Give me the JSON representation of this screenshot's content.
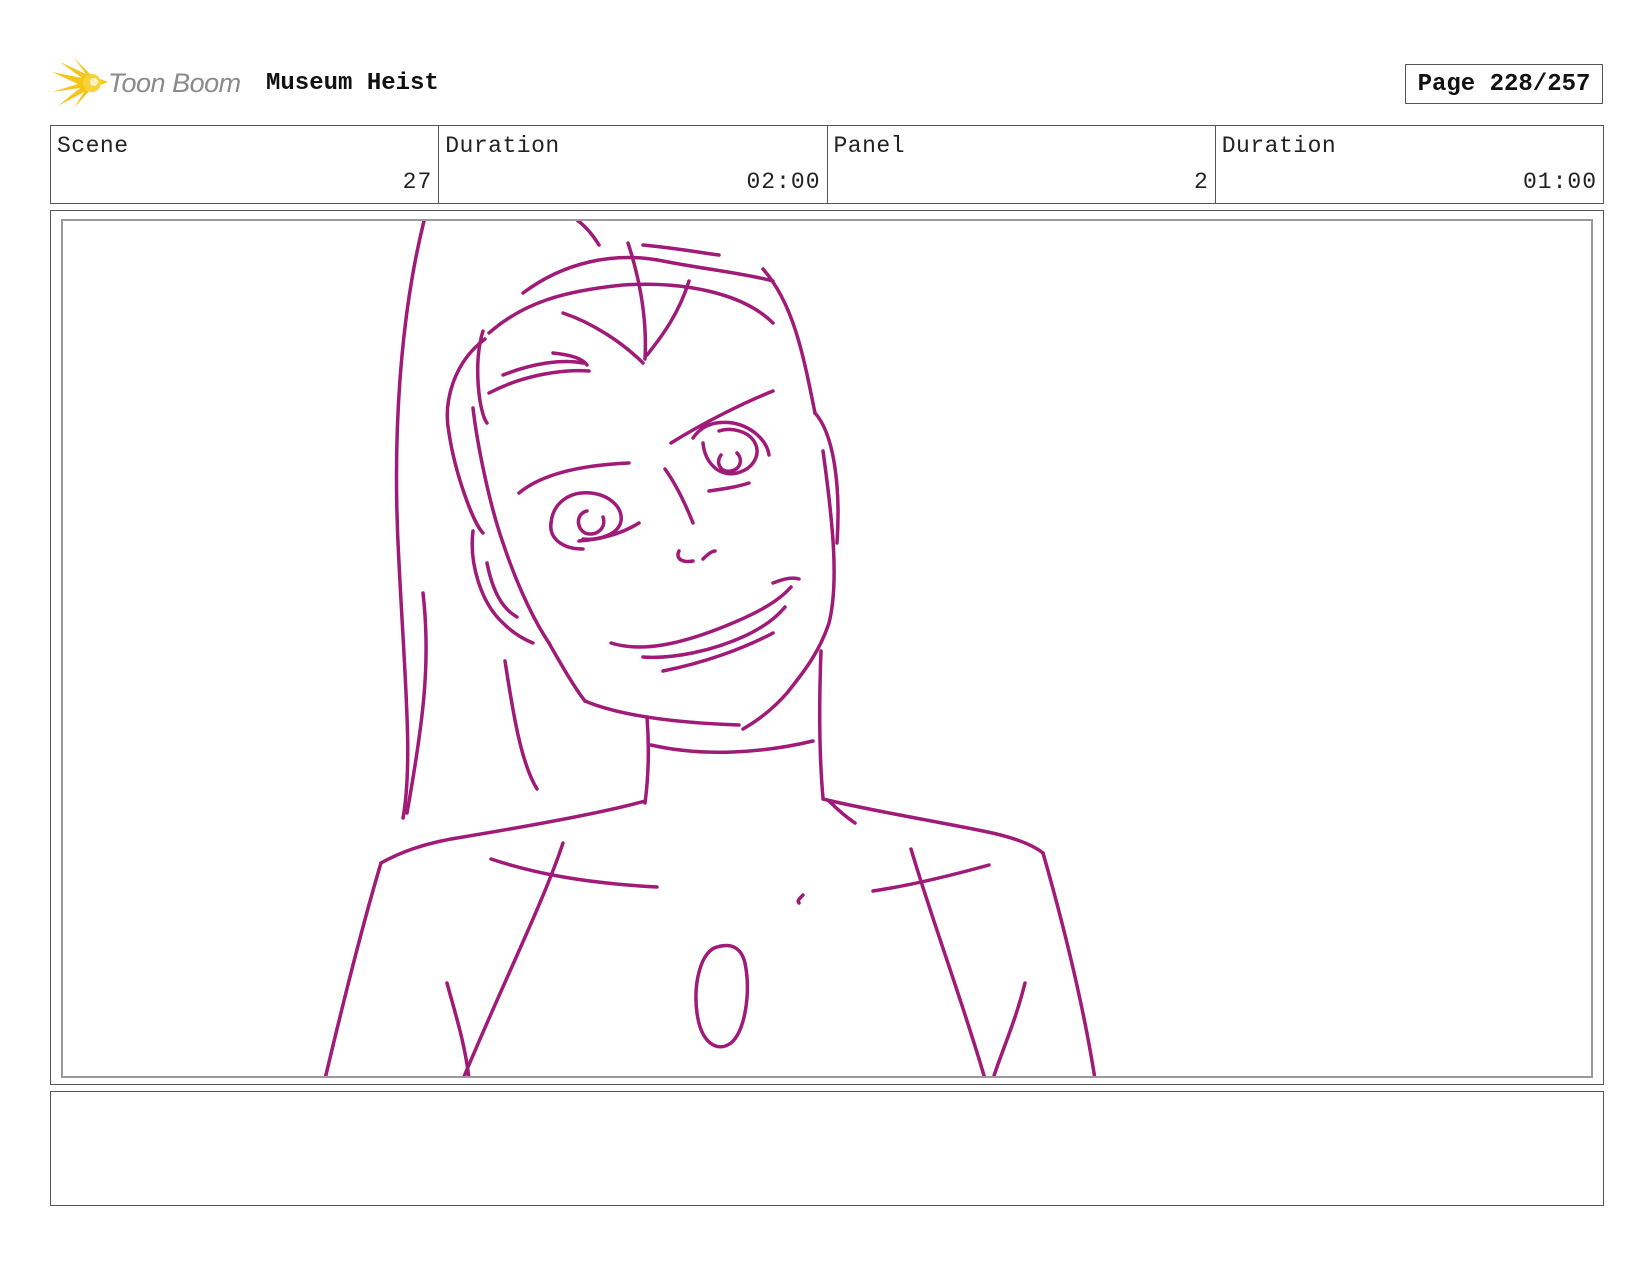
{
  "header": {
    "logo_text": "Toon Boom",
    "project_title": "Museum Heist",
    "page_label": "Page 228/257"
  },
  "info": {
    "scene_label": "Scene",
    "scene_value": "27",
    "scene_duration_label": "Duration",
    "scene_duration_value": "02:00",
    "panel_label": "Panel",
    "panel_value": "2",
    "panel_duration_label": "Duration",
    "panel_duration_value": "01:00"
  },
  "panel": {
    "sketch_color": "#a01a78"
  },
  "notes": {
    "text": ""
  },
  "colors": {
    "logo_star": "#f5c518",
    "border": "#555555",
    "inner_border": "#9a9a9a"
  }
}
